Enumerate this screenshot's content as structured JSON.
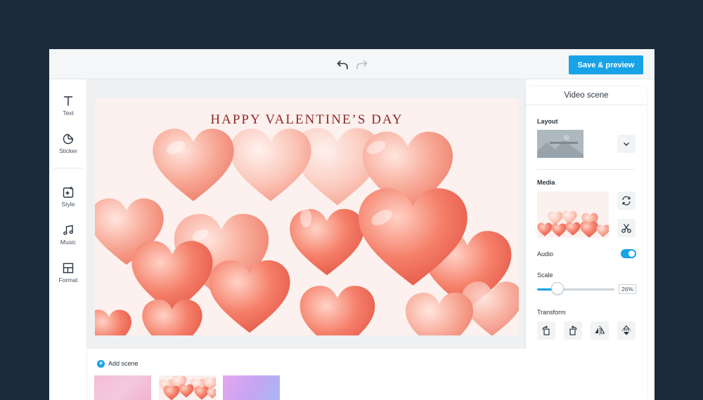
{
  "toolbar": {
    "undo_icon": "undo-icon",
    "redo_icon": "redo-icon",
    "save_label": "Save & preview",
    "accent": "#17a3e6"
  },
  "sidebar": {
    "items": [
      {
        "label": "Text",
        "icon": "text-icon"
      },
      {
        "label": "Sticker",
        "icon": "sticker-icon"
      },
      {
        "label": "Style",
        "icon": "style-icon"
      },
      {
        "label": "Music",
        "icon": "music-icon"
      },
      {
        "label": "Format",
        "icon": "format-icon"
      }
    ]
  },
  "stage": {
    "title": "HAPPY VALENTINE’S DAY",
    "title_color": "#8d2a2a"
  },
  "panel": {
    "title": "Video scene",
    "layout_label": "Layout",
    "media_label": "Media",
    "audio_label": "Audio",
    "audio_on": true,
    "scale_label": "Scale",
    "scale_value": "26%",
    "scale_fraction": 0.26,
    "transform_label": "Transform"
  },
  "scenes": {
    "add_label": "Add scene"
  }
}
